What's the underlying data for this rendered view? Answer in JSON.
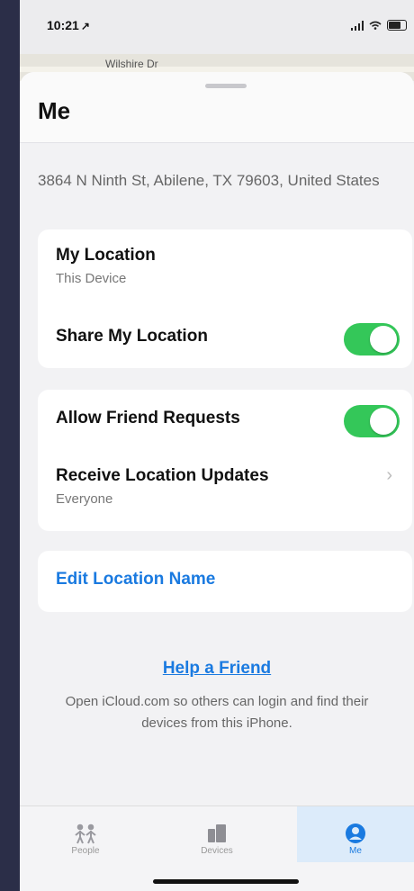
{
  "status_bar": {
    "time": "10:21",
    "location_arrow": "↗",
    "icons": [
      "signal-icon",
      "wifi-icon",
      "battery-icon"
    ]
  },
  "map": {
    "street_label": "Wilshire Dr"
  },
  "sheet": {
    "title": "Me",
    "address": "3864 N Ninth St, Abilene, TX  79603, United States"
  },
  "location_group": {
    "my_location_label": "My Location",
    "my_location_value": "This Device",
    "share_label": "Share My Location",
    "share_enabled": true
  },
  "friends_group": {
    "allow_requests_label": "Allow Friend Requests",
    "allow_requests_enabled": true,
    "receive_updates_label": "Receive Location Updates",
    "receive_updates_value": "Everyone"
  },
  "edit_location_name": "Edit Location Name",
  "help": {
    "link": "Help a Friend",
    "description": "Open iCloud.com so others can login and find their devices from this iPhone."
  },
  "tabbar": {
    "tabs": [
      {
        "label": "People",
        "icon": "people-icon",
        "selected": false
      },
      {
        "label": "Devices",
        "icon": "devices-icon",
        "selected": false
      },
      {
        "label": "Me",
        "icon": "person-icon",
        "selected": true
      }
    ]
  },
  "colors": {
    "accent": "#1a7ae0",
    "toggle_on": "#34c759",
    "background": "#f2f2f4"
  }
}
